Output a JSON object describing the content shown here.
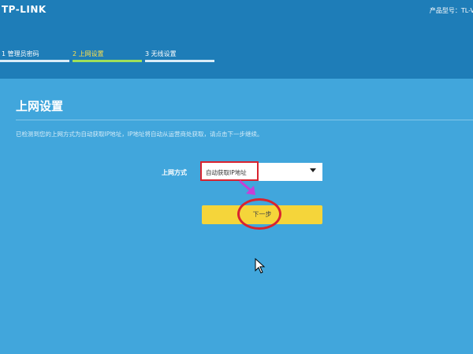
{
  "header": {
    "logo": "TP-LINK",
    "model_label": "产品型号：TL-V"
  },
  "steps": [
    {
      "label": "1 管理员密码",
      "active": false
    },
    {
      "label": "2 上网设置",
      "active": true
    },
    {
      "label": "3 无线设置",
      "active": false
    }
  ],
  "main": {
    "title": "上网设置",
    "description": "已检测到您的上网方式为自动获取IP地址，IP地址将自动从运营商处获取，请点击下一步继续。",
    "connection_label": "上网方式",
    "connection_value": "自动获取IP地址",
    "next_button": "下一步"
  },
  "colors": {
    "header_bg": "#1e7db8",
    "panel_bg": "#41a6dc",
    "active_step": "#ffe24a",
    "button": "#f5d53a",
    "annotation_red": "#d9232f",
    "annotation_arrow": "#c73fd6"
  }
}
